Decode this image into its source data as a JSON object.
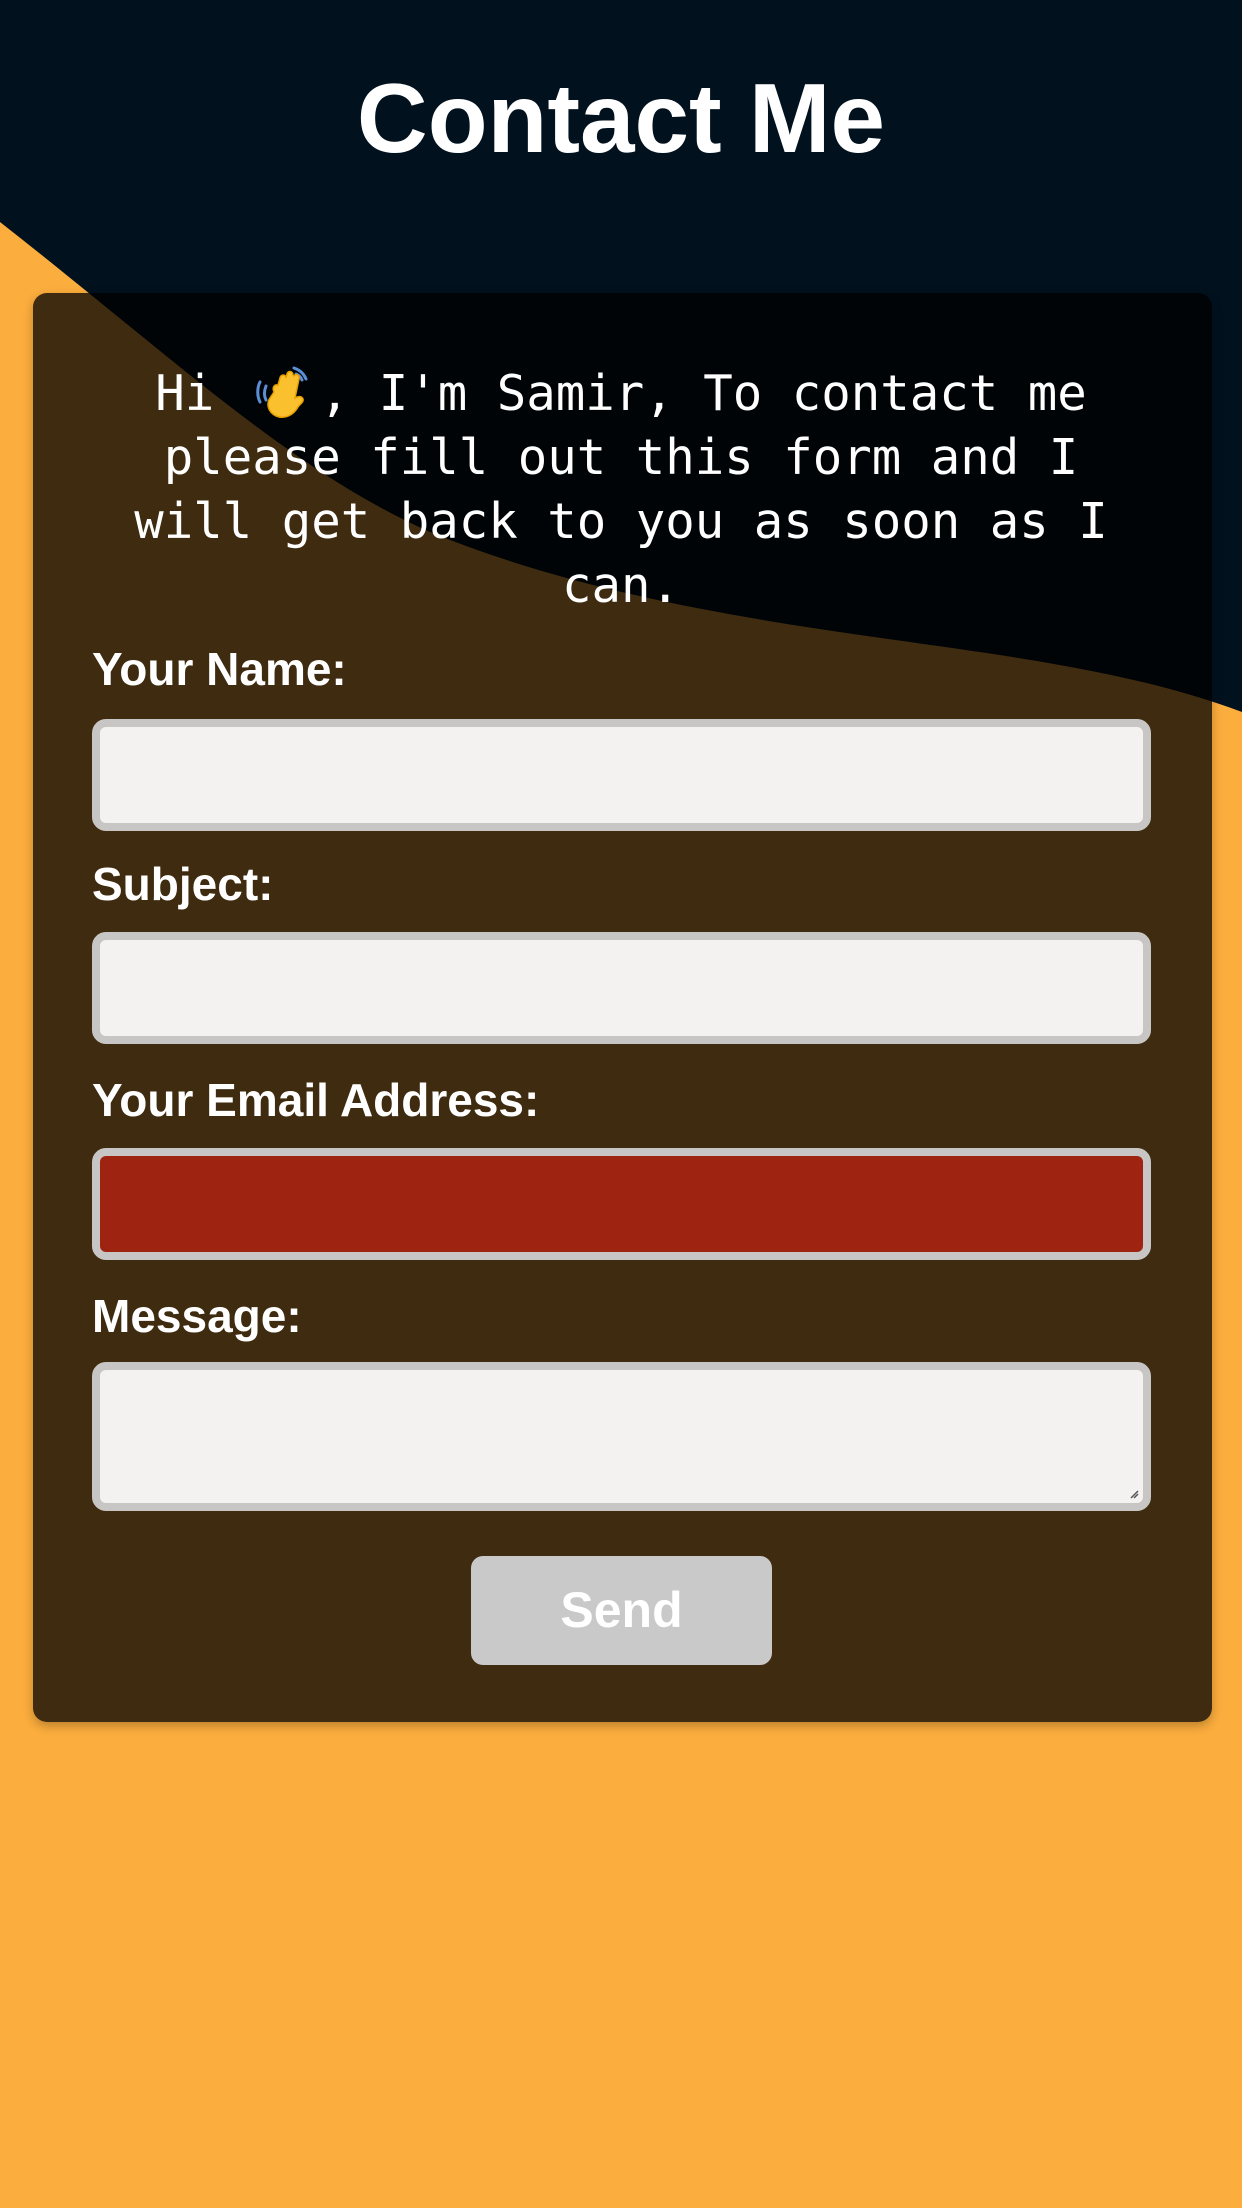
{
  "page": {
    "title": "Contact Me"
  },
  "intro": {
    "greeting": "Hi ",
    "icon": "waving-hand",
    "message": ", I'm Samir, To contact me please fill out this form and I will get back to you as soon as I can."
  },
  "form": {
    "name_label": "Your Name:",
    "name_value": "",
    "subject_label": "Subject:",
    "subject_value": "",
    "email_label": "Your Email Address:",
    "email_value": "",
    "email_state": "invalid",
    "message_label": "Message:",
    "message_value": "",
    "send_label": "Send"
  },
  "colors": {
    "background": "#fbad3d",
    "header": "#01111e",
    "card": "#3f2a12",
    "input": "#f4f2f1",
    "input_invalid": "#9e2411",
    "button": "#c9c9c9"
  }
}
